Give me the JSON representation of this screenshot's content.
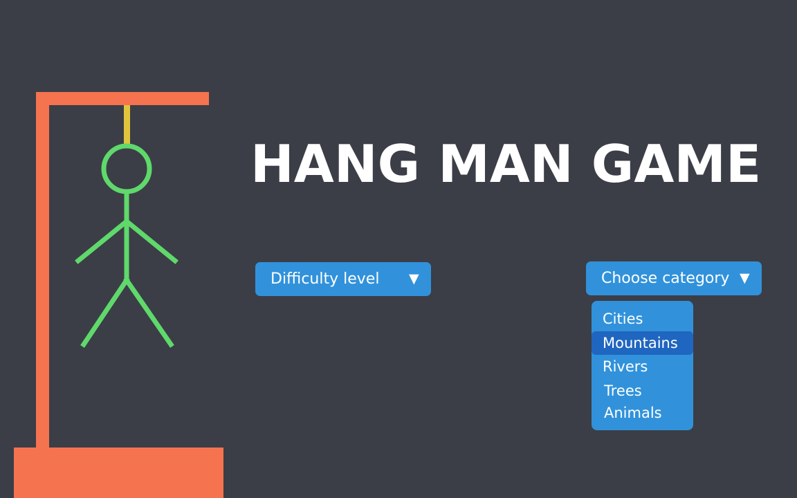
{
  "title": "HANG MAN GAME",
  "colors": {
    "background": "#3b3e46",
    "gallows": "#f5734f",
    "rope": "#e2c43c",
    "figure": "#5fd96b",
    "control": "#3192db",
    "selected_option": "#1f66c0"
  },
  "figure": {
    "parts_shown": [
      "rope",
      "head",
      "body",
      "left-arm",
      "right-arm",
      "left-leg",
      "right-leg"
    ]
  },
  "difficulty": {
    "label": "Difficulty level",
    "arrow": "▼"
  },
  "category": {
    "label": "Choose category",
    "arrow": "▼",
    "options": [
      "Cities",
      "Mountains",
      "Rivers",
      "Trees",
      "Animals"
    ],
    "highlighted": "Mountains"
  }
}
